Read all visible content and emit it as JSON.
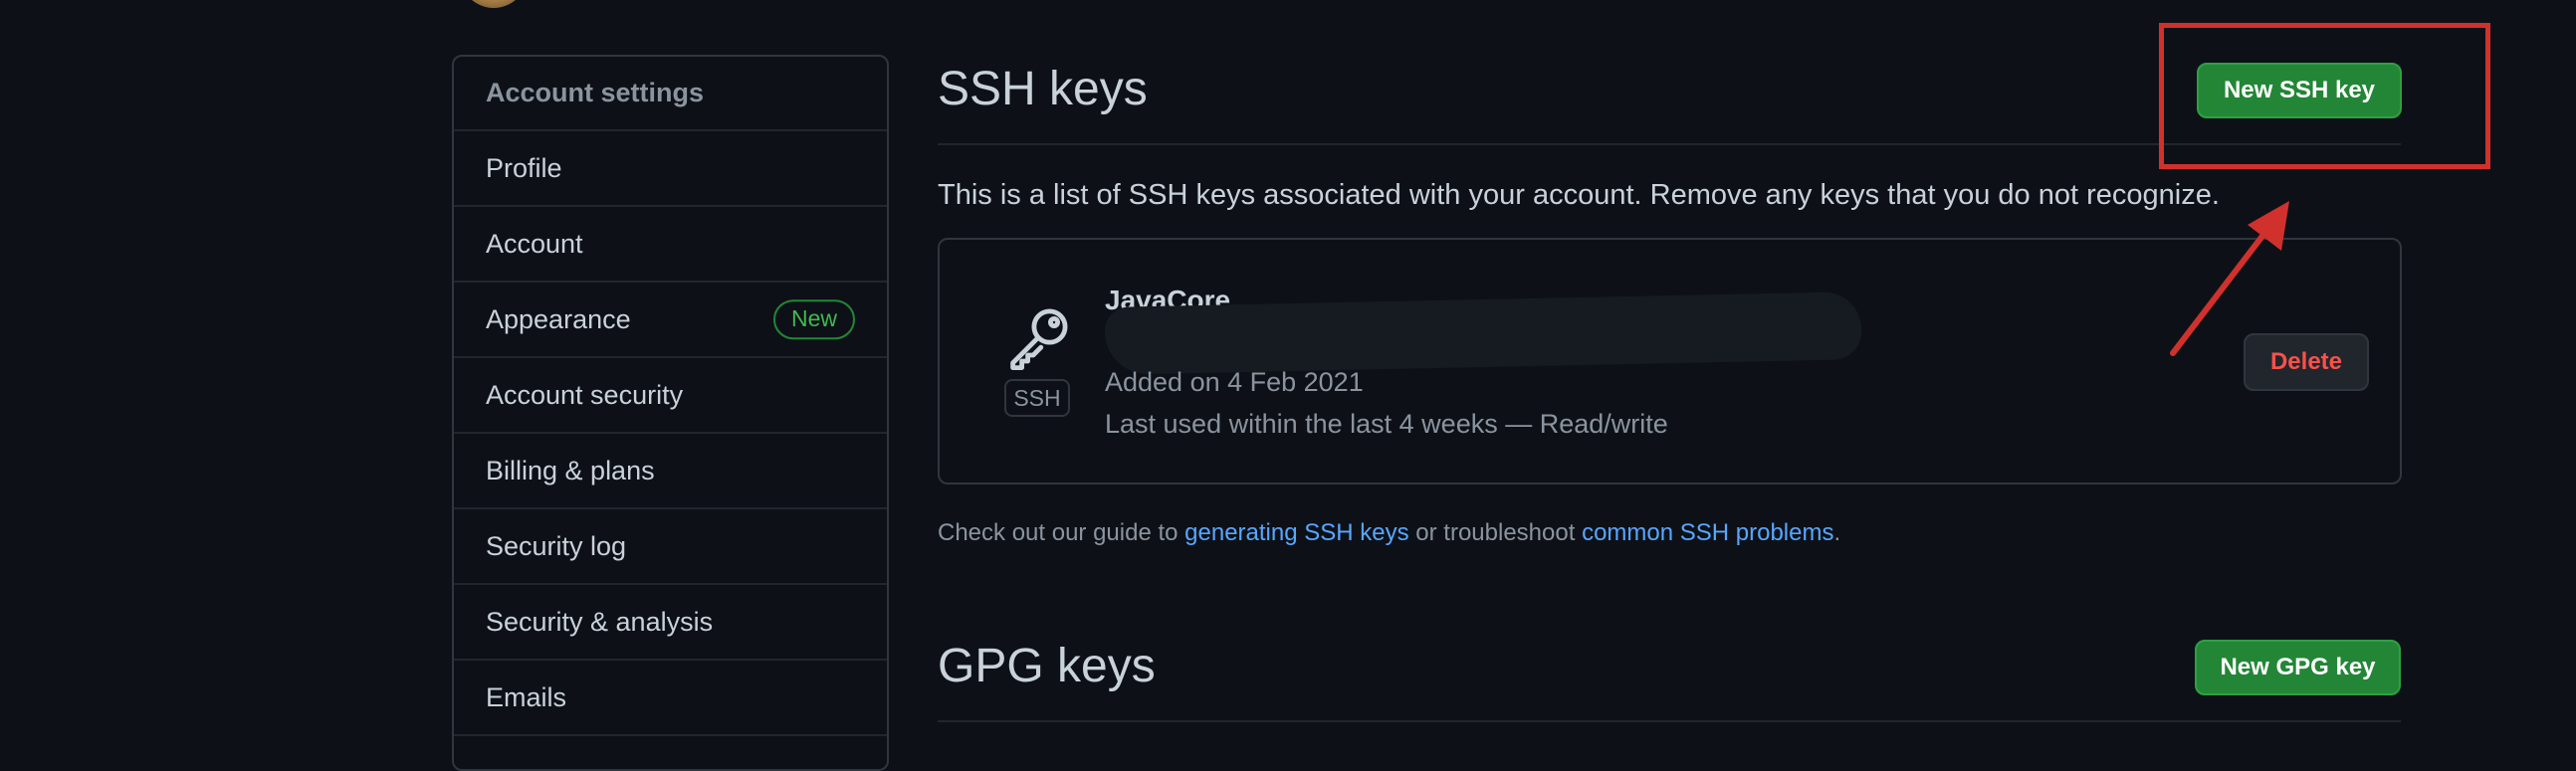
{
  "sidebar": {
    "header": "Account settings",
    "items": [
      {
        "label": "Profile"
      },
      {
        "label": "Account"
      },
      {
        "label": "Appearance",
        "badge": "New"
      },
      {
        "label": "Account security"
      },
      {
        "label": "Billing & plans"
      },
      {
        "label": "Security log"
      },
      {
        "label": "Security & analysis"
      },
      {
        "label": "Emails"
      }
    ]
  },
  "ssh": {
    "title": "SSH keys",
    "new_button": "New SSH key",
    "description": "This is a list of SSH keys associated with your account. Remove any keys that you do not recognize.",
    "key": {
      "name": "JavaCore",
      "type_label": "SSH",
      "icon": "key-icon",
      "added": "Added on 4 Feb 2021",
      "last_used": "Last used within the last 4 weeks — Read/write",
      "delete_button": "Delete"
    },
    "guide": {
      "prefix": "Check out our guide to ",
      "link1": "generating SSH keys",
      "middle": " or troubleshoot ",
      "link2": "common SSH problems",
      "suffix": "."
    }
  },
  "gpg": {
    "title": "GPG keys",
    "new_button": "New GPG key"
  },
  "colors": {
    "background": "#0d1117",
    "primary_button": "#238636",
    "link": "#58a6ff",
    "danger": "#f85149",
    "annotation": "#d0312d"
  }
}
